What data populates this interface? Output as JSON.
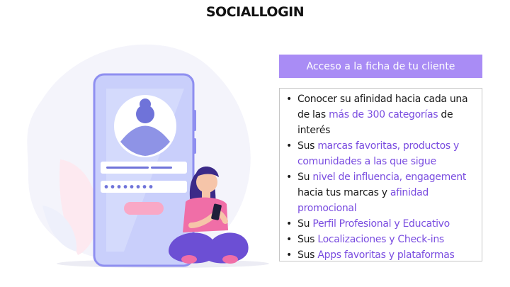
{
  "title": "SOCIALLOGIN",
  "header": "Acceso a la ficha de tu cliente",
  "colors": {
    "accent": "#a98cf5",
    "highlight": "#7a4de0",
    "phone": "#c7cdfa",
    "figure_shirt": "#f06ea7",
    "figure_pants": "#6c4fd4"
  },
  "icons": [
    "user-avatar-icon",
    "smartphone-icon"
  ],
  "bullets": [
    {
      "p1": "Conocer su afinidad hacia cada una de las ",
      "h1": "más de 300 categorías",
      "p2": " de interés",
      "h2": "",
      "p3": ""
    },
    {
      "p1": "Sus ",
      "h1": "marcas favoritas, productos y comunidades a las que sigue",
      "p2": "",
      "h2": "",
      "p3": ""
    },
    {
      "p1": "Su ",
      "h1": "nivel de influencia, engagement",
      "p2": " hacia tus marcas y ",
      "h2": "afinidad promocional",
      "p3": ""
    },
    {
      "p1": "Su ",
      "h1": "Perfil Profesional y Educativo",
      "p2": "",
      "h2": "",
      "p3": ""
    },
    {
      "p1": "Sus ",
      "h1": "Localizaciones y Check-ins",
      "p2": "",
      "h2": "",
      "p3": ""
    },
    {
      "p1": "Sus ",
      "h1": "Apps favoritas y plataformas",
      "p2": "",
      "h2": "",
      "p3": ""
    }
  ]
}
